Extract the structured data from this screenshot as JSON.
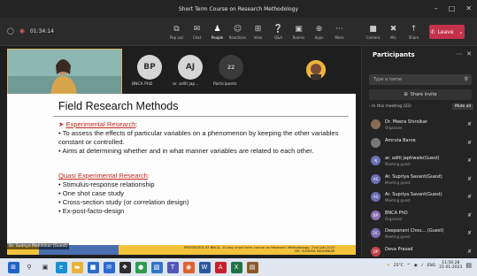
{
  "window": {
    "title": "Short Term Course on Research Methodology",
    "controls": [
      "–",
      "□",
      "✕"
    ]
  },
  "toolbar": {
    "timer": "01:34:14",
    "buttons": [
      {
        "label": "Pop out",
        "icon": "popout-icon",
        "glyph": "⧉"
      },
      {
        "label": "Chat",
        "icon": "chat-icon",
        "glyph": "✉"
      },
      {
        "label": "People",
        "icon": "people-icon",
        "glyph": "♟"
      },
      {
        "label": "Reactions",
        "icon": "reactions-icon",
        "glyph": "☺"
      },
      {
        "label": "View",
        "icon": "view-icon",
        "glyph": "⊞"
      },
      {
        "label": "Q&A",
        "icon": "qa-icon",
        "glyph": "❔"
      },
      {
        "label": "Rooms",
        "icon": "rooms-icon",
        "glyph": "▣"
      },
      {
        "label": "Apps",
        "icon": "apps-icon",
        "glyph": "⊕"
      },
      {
        "label": "More",
        "icon": "more-icon",
        "glyph": "⋯"
      }
    ],
    "device_buttons": [
      {
        "label": "Camera",
        "icon": "camera-icon",
        "glyph": "■"
      },
      {
        "label": "Mic",
        "icon": "mic-off-icon",
        "glyph": "✖"
      },
      {
        "label": "Share",
        "icon": "share-icon",
        "glyph": "↑"
      }
    ],
    "leave_label": "Leave"
  },
  "stage": {
    "tiles": [
      {
        "initials": "BP",
        "label": "BNCA PhD"
      },
      {
        "initials": "AJ",
        "label": "ar. aditi jap..."
      },
      {
        "initials": "22",
        "label": "Participants"
      }
    ],
    "speaker": "Dr. Sudnya Mahimkar (Guest)"
  },
  "slide": {
    "title": "Field Research Methods",
    "section1": "Experimental Research",
    "bullets1": [
      "• To assess the effects of particular variables on a phenomenon by keeping the other variables constant or controlled.",
      "• Aims at determining whether and in what manner variables are related to each other."
    ],
    "section2": "Quasi Experimental Research",
    "bullets2": [
      "• Stimulus-response relationship",
      "• One shot case study",
      "• Cross-section study (or correlation design)",
      "• Ex-post-facto-design"
    ],
    "footer": "PRESENTED AT BNCA- 10-day short term course on Research Methodology: 21st JAN 2023",
    "footer2": "DR. SUDNYA MAHIMKAR"
  },
  "sidebar": {
    "title": "Participants",
    "search_placeholder": "Type a name",
    "share_invite": "Share invite",
    "in_meeting": "In this meeting (22)",
    "mute_all": "Mute all",
    "participants": [
      {
        "name": "Dr. Meera Shirolkar",
        "role": "Organizer",
        "initials": "",
        "color": "#8a6b55"
      },
      {
        "name": "Amruta Barve",
        "role": "",
        "initials": "",
        "color": "#777777"
      },
      {
        "name": "ar. aditi japtiwale(Guest)",
        "role": "Meeting guest",
        "initials": "AJ",
        "color": "#6a6fb5"
      },
      {
        "name": "Ar. Supriya Savant(Guest)",
        "role": "Meeting guest",
        "initials": "AS",
        "color": "#6a6fb5"
      },
      {
        "name": "Ar. Supriya Savant(Guest)",
        "role": "Meeting guest",
        "initials": "AS",
        "color": "#6a6fb5"
      },
      {
        "name": "BNCA PhD",
        "role": "Organizer",
        "initials": "BP",
        "color": "#8a6fb5"
      },
      {
        "name": "Deepanani Chou... (Guest)",
        "role": "Meeting guest",
        "initials": "DC",
        "color": "#7d6bb0"
      },
      {
        "name": "Deva Prasad",
        "role": "",
        "initials": "DP",
        "color": "#c2444a"
      }
    ]
  },
  "taskbar": {
    "weather": "25°C",
    "lang": "ENG",
    "time": "11:56:28",
    "date": "21-01-2023"
  }
}
